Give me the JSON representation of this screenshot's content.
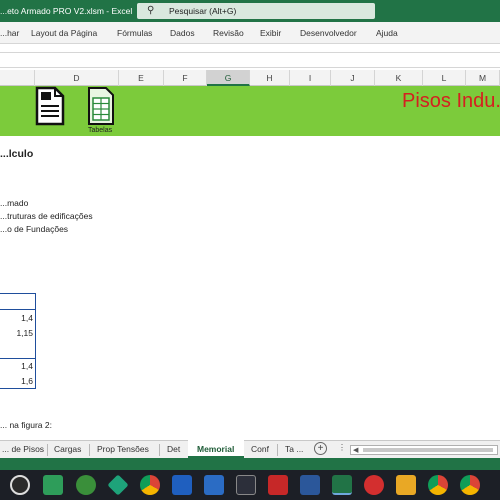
{
  "window": {
    "title": "...eto Armado PRO V2.xlsm  -  Excel",
    "search_placeholder": "Pesquisar (Alt+G)"
  },
  "ribbon": {
    "tabs": [
      "...har",
      "Layout da Página",
      "Fórmulas",
      "Dados",
      "Revisão",
      "Exibir",
      "Desenvolvedor",
      "Ajuda"
    ]
  },
  "columns": [
    "D",
    "E",
    "F",
    "G",
    "H",
    "I",
    "J",
    "K",
    "L",
    "M"
  ],
  "selected_column": "G",
  "header": {
    "icon_label": "Tabelas",
    "brand": "Pisos Indu..."
  },
  "sheet": {
    "heading": "...lculo",
    "lines": [
      "...mado",
      "...truturas de edificações",
      "...o de Fundações"
    ],
    "values_group1": [
      "1,4",
      "1,15"
    ],
    "values_group2": [
      "1,4",
      "1,6"
    ],
    "footnote": "... na figura 2:"
  },
  "sheet_tabs": [
    "... de Pisos",
    "Cargas",
    "Prop Tensões",
    "Det",
    "Memorial",
    "Conf",
    "Ta ..."
  ],
  "active_sheet_tab": "Memorial",
  "colors": {
    "excel_green": "#217346",
    "band_green": "#7ccb3b",
    "brand_red": "#d42020",
    "table_border": "#1f4e9c"
  },
  "taskbar_icons": [
    "obs-icon",
    "gallery-icon",
    "steam-icon",
    "gamepad-icon",
    "chrome-icon",
    "revit-icon",
    "autocad-icon",
    "gamma-icon",
    "ram-icon",
    "word-icon",
    "excel-icon",
    "camtasia-icon",
    "app-icon",
    "chrome-icon",
    "chrome-icon"
  ]
}
